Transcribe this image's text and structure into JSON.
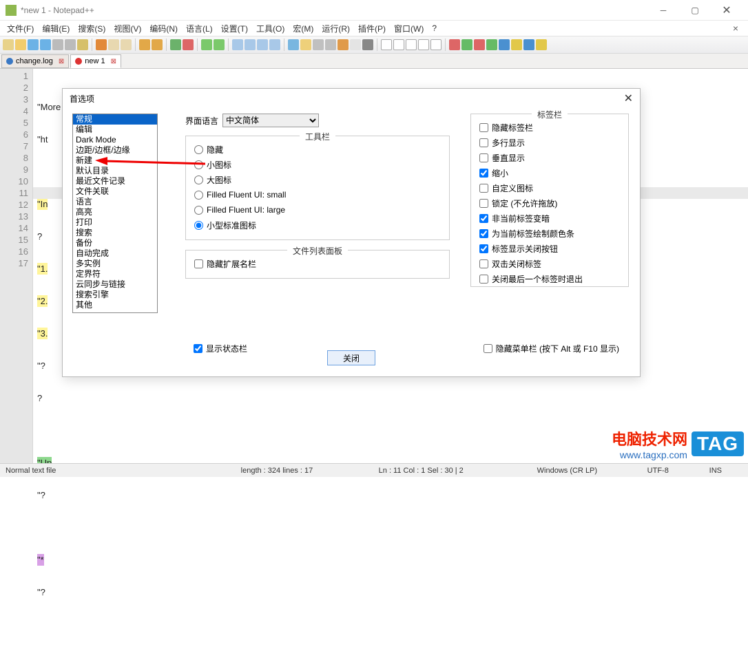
{
  "titlebar": {
    "text": "*new 1 - Notepad++"
  },
  "menus": [
    "文件(F)",
    "编辑(E)",
    "搜索(S)",
    "视图(V)",
    "编码(N)",
    "语言(L)",
    "设置(T)",
    "工具(O)",
    "宏(M)",
    "运行(R)",
    "插件(P)",
    "窗口(W)",
    "?"
  ],
  "tabs": [
    {
      "label": "change.log",
      "active": false
    },
    {
      "label": "new 1",
      "active": true
    }
  ],
  "editor": {
    "lines": [
      "1",
      "2",
      "3",
      "4",
      "5",
      "6",
      "7",
      "8",
      "9",
      "10",
      "11",
      "12",
      "13",
      "14",
      "15",
      "16",
      "17"
    ],
    "rows": [
      "\"More fixes & implementations detail:?",
      "\"ht",
      "",
      "\"In",
      "?",
      "\"1.",
      "\"2.",
      "\"3.",
      "\"?",
      "?",
      "",
      "\"Up",
      "\"?",
      "",
      "\"*",
      "\"?",
      ""
    ]
  },
  "dlg": {
    "title": "首选项",
    "categories": [
      "常规",
      "编辑",
      "Dark Mode",
      "边距/边框/边缘",
      "新建",
      "默认目录",
      "最近文件记录",
      "文件关联",
      "语言",
      "高亮",
      "打印",
      "搜索",
      "备份",
      "自动完成",
      "多实例",
      "定界符",
      "云同步与链接",
      "搜索引擎",
      "其他"
    ],
    "lang_label": "界面语言",
    "lang_value": "中文简体",
    "toolbar_group": "工具栏",
    "toolbar_opts": [
      "隐藏",
      "小图标",
      "大图标",
      "Filled Fluent UI: small",
      "Filled Fluent UI: large",
      "小型标准图标"
    ],
    "filelist_group": "文件列表面板",
    "filelist_opt": "隐藏扩展名栏",
    "tabbar_group": "标签栏",
    "tabbar_opts": [
      {
        "label": "隐藏标签栏",
        "checked": false
      },
      {
        "label": "多行显示",
        "checked": false
      },
      {
        "label": "垂直显示",
        "checked": false
      },
      {
        "label": "缩小",
        "checked": true
      },
      {
        "label": "自定义图标",
        "checked": false
      },
      {
        "label": "锁定 (不允许拖放)",
        "checked": false
      },
      {
        "label": "非当前标签变暗",
        "checked": true
      },
      {
        "label": "为当前标签绘制颜色条",
        "checked": true
      },
      {
        "label": "标签显示关闭按钮",
        "checked": true
      },
      {
        "label": "双击关闭标签",
        "checked": false
      },
      {
        "label": "关闭最后一个标签时退出",
        "checked": false
      }
    ],
    "show_status": "显示状态栏",
    "hide_menu": "隐藏菜单栏 (按下 Alt 或 F10 显示)",
    "close_btn": "关闭"
  },
  "status": {
    "filetype": "Normal text file",
    "length": "length : 324    lines : 17",
    "pos": "Ln : 11    Col : 1    Sel : 30 | 2",
    "eol": "Windows (CR LP)",
    "enc": "UTF-8",
    "ins": "INS"
  },
  "watermark": {
    "l1": "电脑技术网",
    "l2": "www.tagxp.com",
    "tag": "TAG"
  }
}
